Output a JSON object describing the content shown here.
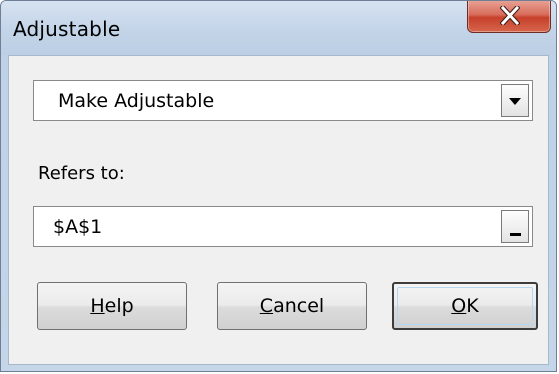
{
  "window": {
    "title": "Adjustable",
    "close_icon": "close-icon"
  },
  "combo": {
    "selected_value": "Make Adjustable",
    "arrow_icon": "chevron-down-icon"
  },
  "refers": {
    "label": "Refers to:",
    "value": "$A$1",
    "collapse_icon": "collapse-dialog-icon"
  },
  "buttons": {
    "help": {
      "mnemonic": "H",
      "rest": "elp"
    },
    "cancel": {
      "mnemonic": "C",
      "rest": "ancel"
    },
    "ok": {
      "mnemonic": "O",
      "rest": "K"
    }
  },
  "colors": {
    "close_button": "#c7402b",
    "titlebar": "#c3d4e8",
    "client_bg": "#f0f0f0"
  }
}
